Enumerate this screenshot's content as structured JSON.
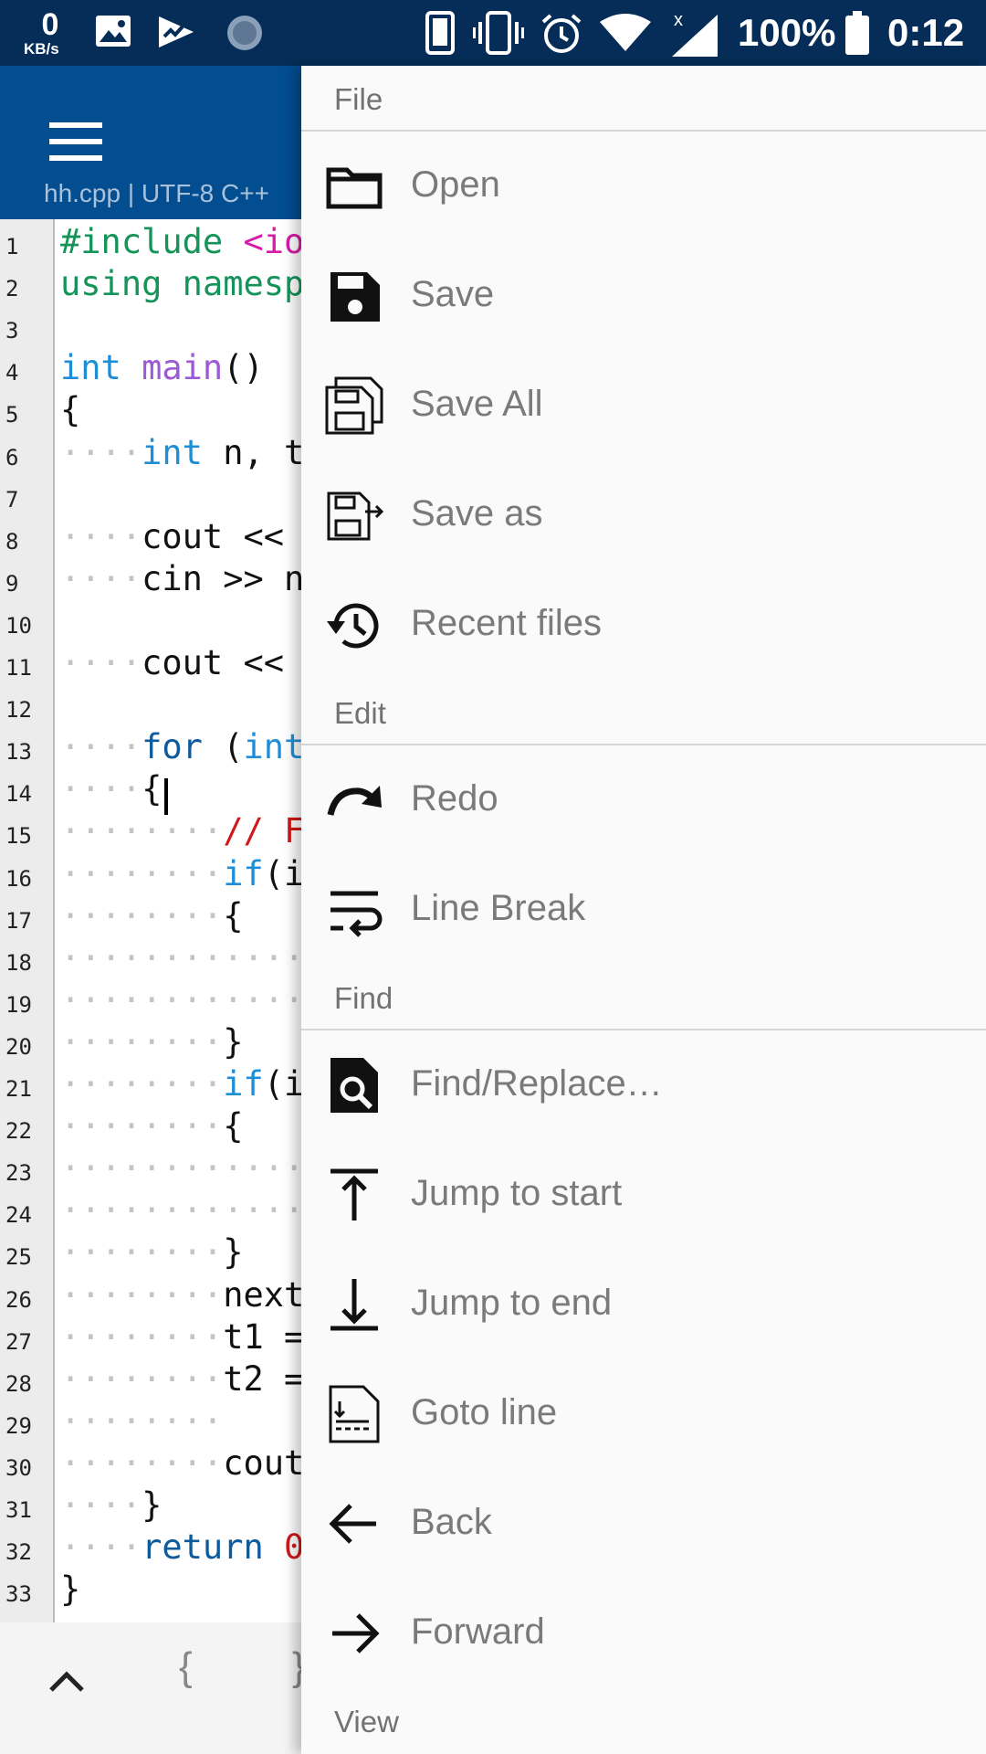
{
  "status_bar": {
    "speed_value": "0",
    "speed_unit": "KB/s",
    "battery_percent": "100%",
    "time": "0:12",
    "icons": [
      "gallery-icon",
      "play-icon",
      "sync-icon",
      "phone-icon",
      "vibrate-icon",
      "alarm-icon",
      "wifi-icon",
      "signal-icon",
      "battery-icon"
    ]
  },
  "app_bar": {
    "file_info": "hh.cpp  |  UTF-8  C++"
  },
  "editor": {
    "line_numbers": [
      "1",
      "2",
      "3",
      "4",
      "5",
      "6",
      "7",
      "8",
      "9",
      "10",
      "11",
      "12",
      "13",
      "14",
      "15",
      "16",
      "17",
      "18",
      "19",
      "20",
      "21",
      "22",
      "23",
      "24",
      "25",
      "26",
      "27",
      "28",
      "29",
      "30",
      "31",
      "32",
      "33"
    ],
    "lines": [
      {
        "dots": "",
        "segments": [
          {
            "t": "#include",
            "c": "kw-prep"
          },
          {
            "t": " ",
            "c": "dots"
          },
          {
            "t": "<io",
            "c": "kw-pink"
          }
        ]
      },
      {
        "dots": "",
        "segments": [
          {
            "t": "using",
            "c": "kw-prep"
          },
          {
            "t": " ",
            "c": "dots"
          },
          {
            "t": "namesp",
            "c": "kw-prep"
          }
        ]
      },
      {
        "dots": "",
        "segments": []
      },
      {
        "dots": "",
        "segments": [
          {
            "t": "int",
            "c": "kw-blue"
          },
          {
            "t": " ",
            "c": "dots"
          },
          {
            "t": "main",
            "c": "kw-purple"
          },
          {
            "t": "()",
            "c": ""
          }
        ]
      },
      {
        "dots": "",
        "segments": [
          {
            "t": "{",
            "c": ""
          }
        ]
      },
      {
        "dots": "····",
        "segments": [
          {
            "t": "int",
            "c": "kw-blue"
          },
          {
            "t": " n, t",
            "c": ""
          }
        ]
      },
      {
        "dots": "",
        "segments": []
      },
      {
        "dots": "····",
        "segments": [
          {
            "t": "cout << ",
            "c": ""
          }
        ]
      },
      {
        "dots": "····",
        "segments": [
          {
            "t": "cin >> n",
            "c": ""
          }
        ]
      },
      {
        "dots": "",
        "segments": []
      },
      {
        "dots": "····",
        "segments": [
          {
            "t": "cout << ",
            "c": ""
          }
        ]
      },
      {
        "dots": "",
        "segments": []
      },
      {
        "dots": "····",
        "segments": [
          {
            "t": "for",
            "c": "kw-dkblue"
          },
          {
            "t": " (",
            "c": ""
          },
          {
            "t": "int",
            "c": "kw-blue"
          }
        ]
      },
      {
        "dots": "····",
        "segments": [
          {
            "t": "{",
            "c": ""
          }
        ]
      },
      {
        "dots": "········",
        "segments": [
          {
            "t": "// F",
            "c": "kw-red"
          }
        ]
      },
      {
        "dots": "········",
        "segments": [
          {
            "t": "if",
            "c": "kw-blue"
          },
          {
            "t": "(i",
            "c": ""
          }
        ]
      },
      {
        "dots": "········",
        "segments": [
          {
            "t": "{",
            "c": ""
          }
        ]
      },
      {
        "dots": "··············",
        "segments": []
      },
      {
        "dots": "··············",
        "segments": []
      },
      {
        "dots": "········",
        "segments": [
          {
            "t": "}",
            "c": ""
          }
        ]
      },
      {
        "dots": "········",
        "segments": [
          {
            "t": "if",
            "c": "kw-blue"
          },
          {
            "t": "(i",
            "c": ""
          }
        ]
      },
      {
        "dots": "········",
        "segments": [
          {
            "t": "{",
            "c": ""
          }
        ]
      },
      {
        "dots": "··············",
        "segments": []
      },
      {
        "dots": "··············",
        "segments": []
      },
      {
        "dots": "········",
        "segments": [
          {
            "t": "}",
            "c": ""
          }
        ]
      },
      {
        "dots": "········",
        "segments": [
          {
            "t": "next",
            "c": ""
          }
        ]
      },
      {
        "dots": "········",
        "segments": [
          {
            "t": "t1 =",
            "c": ""
          }
        ]
      },
      {
        "dots": "········",
        "segments": [
          {
            "t": "t2 =",
            "c": ""
          }
        ]
      },
      {
        "dots": "········",
        "segments": []
      },
      {
        "dots": "········",
        "segments": [
          {
            "t": "cout",
            "c": ""
          }
        ]
      },
      {
        "dots": "····",
        "segments": [
          {
            "t": "}",
            "c": ""
          }
        ]
      },
      {
        "dots": "····",
        "segments": [
          {
            "t": "return",
            "c": "kw-dkblue"
          },
          {
            "t": " 0",
            "c": "kw-red"
          }
        ]
      },
      {
        "dots": "",
        "segments": [
          {
            "t": "}",
            "c": ""
          }
        ]
      }
    ]
  },
  "bottom_bar": {
    "brace_open": "{",
    "brace_close": "}"
  },
  "drawer": {
    "sections": [
      {
        "header": "File",
        "items": [
          {
            "label": "Open",
            "icon": "folder-icon"
          },
          {
            "label": "Save",
            "icon": "save-icon"
          },
          {
            "label": "Save All",
            "icon": "save-all-icon"
          },
          {
            "label": "Save as",
            "icon": "save-as-icon"
          },
          {
            "label": "Recent files",
            "icon": "history-icon"
          }
        ]
      },
      {
        "header": "Edit",
        "items": [
          {
            "label": "Redo",
            "icon": "redo-icon"
          },
          {
            "label": "Line Break",
            "icon": "wrap-icon"
          }
        ]
      },
      {
        "header": "Find",
        "items": [
          {
            "label": "Find/Replace…",
            "icon": "find-replace-icon"
          },
          {
            "label": "Jump to start",
            "icon": "jump-start-icon"
          },
          {
            "label": "Jump to end",
            "icon": "jump-end-icon"
          },
          {
            "label": "Goto line",
            "icon": "goto-line-icon"
          },
          {
            "label": "Back",
            "icon": "arrow-left-icon"
          },
          {
            "label": "Forward",
            "icon": "arrow-right-icon"
          }
        ]
      },
      {
        "header": "View",
        "items": []
      }
    ]
  },
  "colors": {
    "status_bar": "#052d57",
    "app_bar": "#034d91",
    "drawer_bg": "#fafafa",
    "label_text": "#7a7a7a"
  }
}
